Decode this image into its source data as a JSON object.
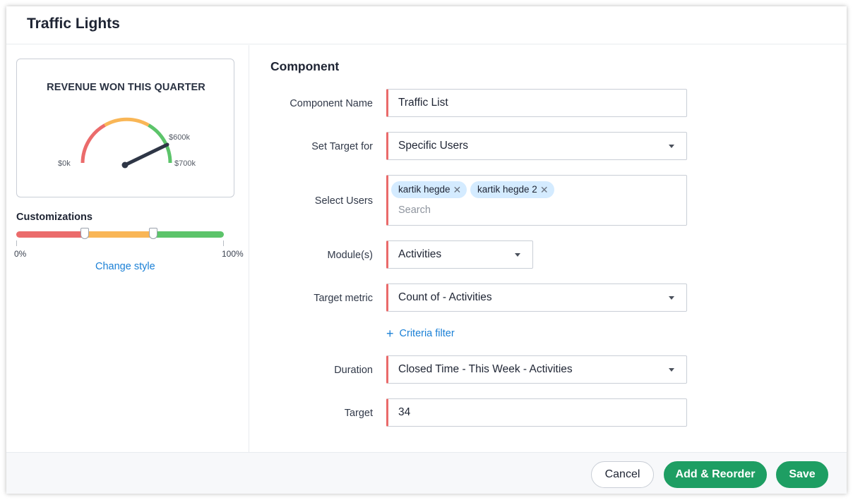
{
  "dialog": {
    "title": "Traffic Lights"
  },
  "preview": {
    "title": "REVENUE WON THIS QUARTER",
    "gauge_labels": {
      "min": "$0k",
      "upper": "$600k",
      "max": "$700k"
    },
    "colors": {
      "red": "#eb6b6b",
      "yellow": "#f9b656",
      "green": "#5cc46a",
      "needle": "#2e3646"
    }
  },
  "customizations": {
    "title": "Customizations",
    "scale_min": "0%",
    "scale_max": "100%",
    "thresholds_fraction": [
      0.33,
      0.66
    ],
    "change_style": "Change style"
  },
  "form": {
    "section_title": "Component",
    "component_name": {
      "label": "Component Name",
      "value": "Traffic List"
    },
    "set_target_for": {
      "label": "Set Target for",
      "value": "Specific Users"
    },
    "select_users": {
      "label": "Select Users",
      "chips": [
        "kartik hegde",
        "kartik hegde 2"
      ],
      "placeholder": "Search"
    },
    "modules": {
      "label": "Module(s)",
      "value": "Activities"
    },
    "target_metric": {
      "label": "Target metric",
      "value": "Count of - Activities"
    },
    "criteria_filter": "Criteria filter",
    "duration": {
      "label": "Duration",
      "value": "Closed Time - This Week - Activities"
    },
    "target": {
      "label": "Target",
      "value": "34"
    }
  },
  "footer": {
    "cancel": "Cancel",
    "add_reorder": "Add & Reorder",
    "save": "Save"
  },
  "accent_colors": {
    "primary_green": "#1e9e63",
    "link_blue": "#1b80d6",
    "required_red": "#ea6a6a",
    "chip_blue": "#d4ebff"
  }
}
